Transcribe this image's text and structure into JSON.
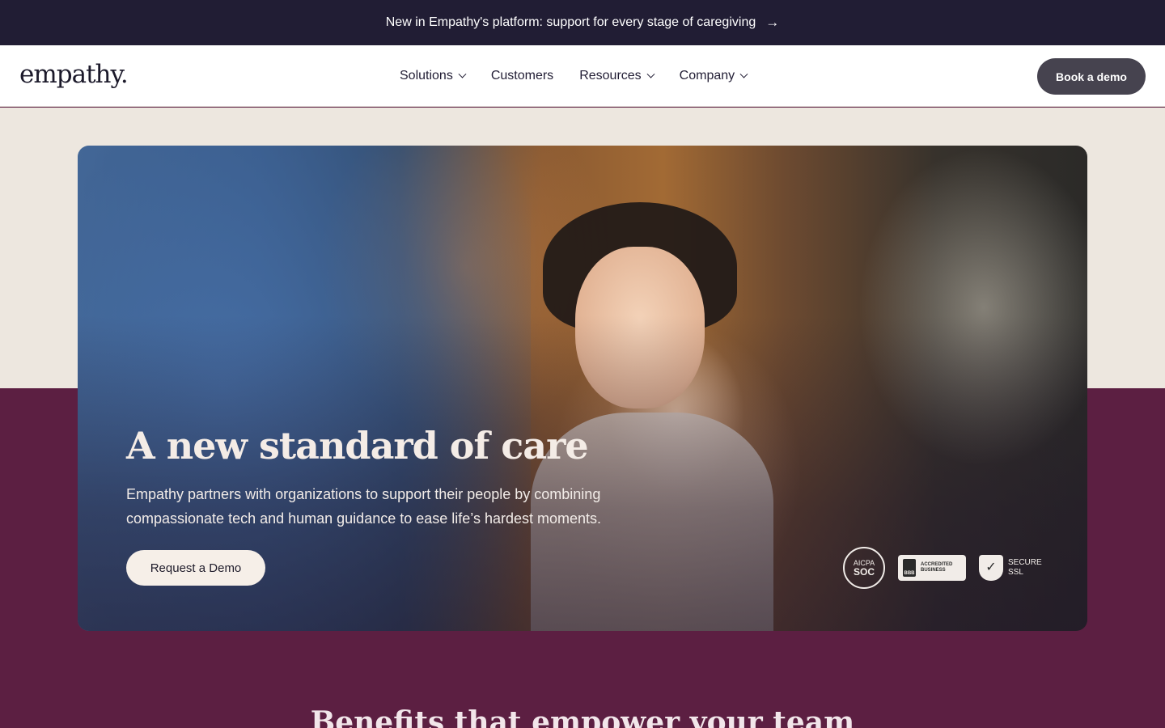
{
  "announcement": {
    "text": "New in Empathy's platform: support for every stage of caregiving",
    "arrow_icon": "arrow-right-icon"
  },
  "nav": {
    "logo": "empathy.",
    "items": [
      {
        "label": "Solutions",
        "dropdown": true
      },
      {
        "label": "Customers",
        "dropdown": false
      },
      {
        "label": "Resources",
        "dropdown": true
      },
      {
        "label": "Company",
        "dropdown": true
      }
    ],
    "cta_label": "Book a demo"
  },
  "hero": {
    "title": "A new standard of care",
    "subtitle": "Empathy partners with organizations to support their people by combining compassionate tech and human guidance to ease life’s hardest moments.",
    "button_label": "Request a Demo",
    "badges": {
      "soc_top": "AICPA",
      "soc_main": "SOC",
      "bbb_mark": "BBB",
      "bbb_text_1": "ACCREDITED",
      "bbb_text_2": "BUSINESS",
      "ssl_1": "SECURE",
      "ssl_2": "SSL"
    }
  },
  "next_section": {
    "title": "Benefits that empower your team"
  },
  "colors": {
    "announcement_bg": "#211d34",
    "cta_bg": "#46434f",
    "beige_band": "#ede7df",
    "plum_band": "#5c1f42"
  }
}
